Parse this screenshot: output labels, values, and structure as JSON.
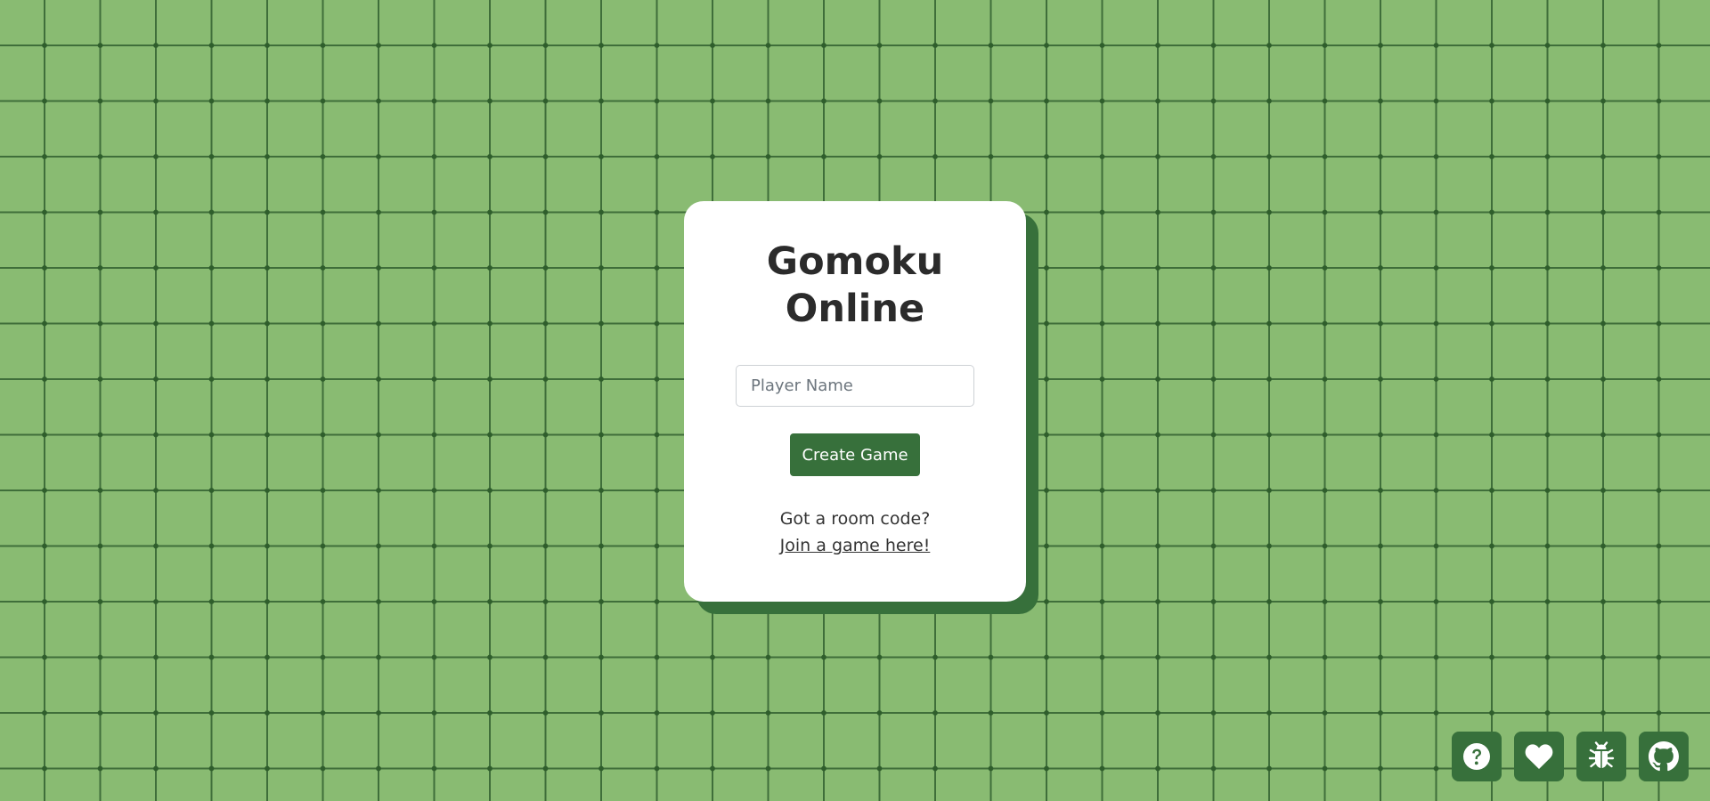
{
  "app": {
    "title_line1": "Gomoku",
    "title_line2": "Online"
  },
  "form": {
    "player_name_placeholder": "Player Name",
    "player_name_value": "",
    "create_button_label": "Create Game"
  },
  "join": {
    "prompt": "Got a room code?",
    "link_label": "Join a game here!"
  },
  "footer_icons": [
    {
      "name": "question-icon"
    },
    {
      "name": "heart-icon"
    },
    {
      "name": "bug-icon"
    },
    {
      "name": "github-icon"
    }
  ],
  "colors": {
    "background": "#89bb72",
    "grid_line": "#3f6e3a",
    "accent": "#37703b",
    "card": "#ffffff"
  }
}
